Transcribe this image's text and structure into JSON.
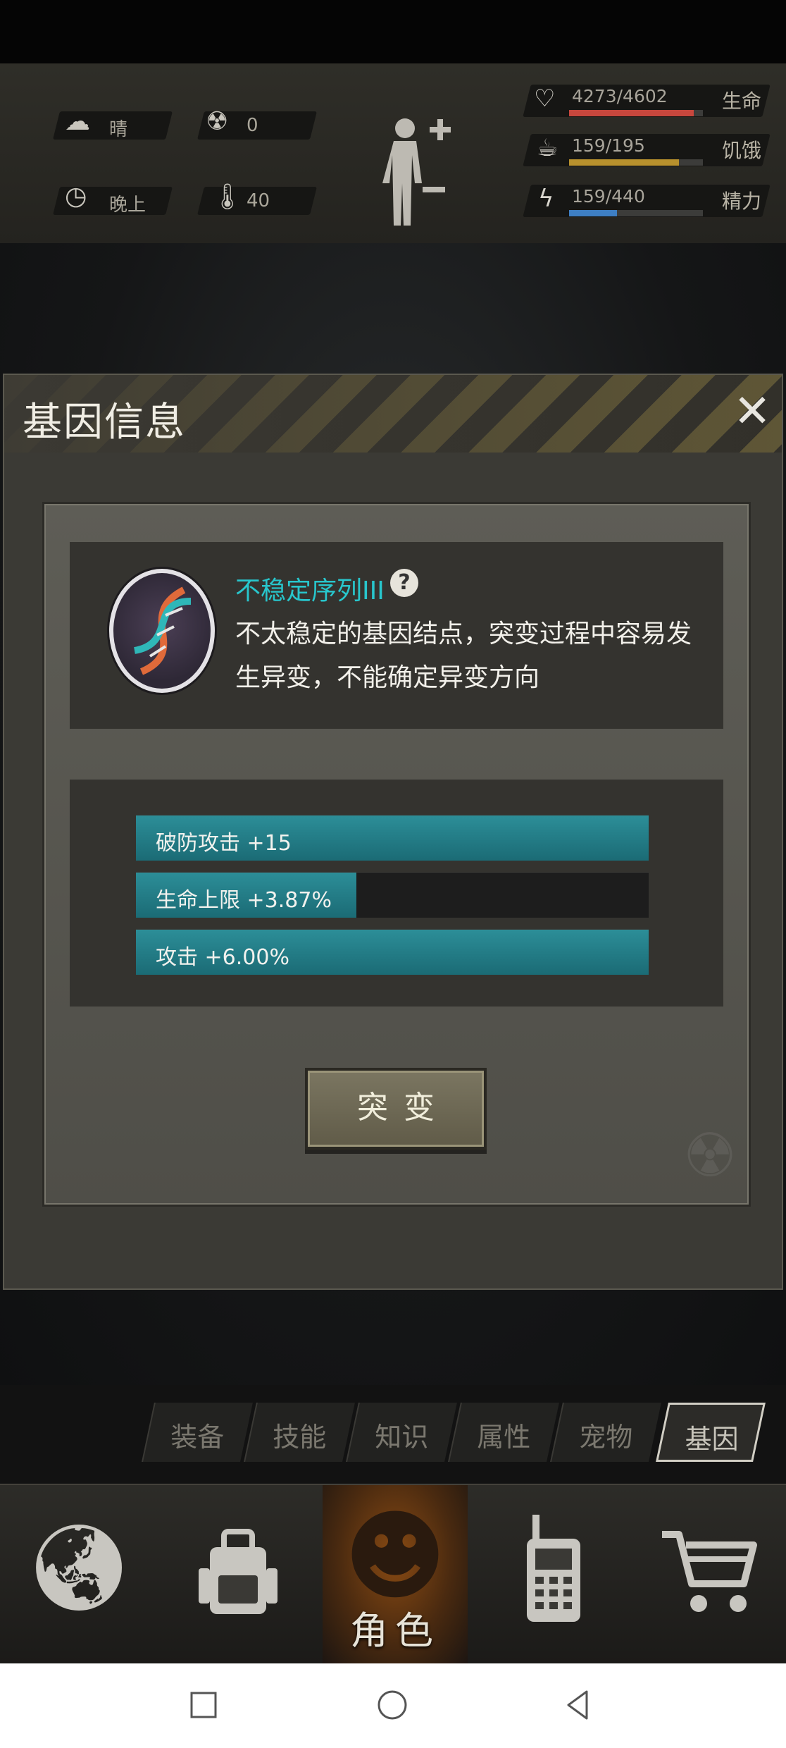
{
  "hud": {
    "weather": {
      "icon": "cloud-sun-icon",
      "label": "晴"
    },
    "radiation": {
      "icon": "radiation-icon",
      "value": "0"
    },
    "time": {
      "icon": "clock-icon",
      "label": "晚上"
    },
    "temperature": {
      "icon": "thermometer-icon",
      "value": "40"
    },
    "body_icon": "body-figure-icon",
    "stats": [
      {
        "name": "生命",
        "value": "4273/4602",
        "fraction": 0.93,
        "color": "#c8473d",
        "icon": "heart-pulse-icon"
      },
      {
        "name": "饥饿",
        "value": "159/195",
        "fraction": 0.82,
        "color": "#b8912d",
        "icon": "stomach-icon"
      },
      {
        "name": "精力",
        "value": "159/440",
        "fraction": 0.36,
        "color": "#3e7fc4",
        "icon": "energy-icon"
      }
    ]
  },
  "dialog": {
    "title": "基因信息",
    "close_icon": "close-icon",
    "gene": {
      "icon": "dna-icon",
      "name": "不稳定序列III",
      "help_icon": "?",
      "description": "不太稳定的基因结点，突变过程中容易发生异变，不能确定异变方向"
    },
    "bonuses": [
      {
        "label": "破防攻击 +15",
        "fraction": 1.0
      },
      {
        "label": "生命上限 +3.87%",
        "fraction": 0.43
      },
      {
        "label": "攻击 +6.00%",
        "fraction": 1.0
      }
    ],
    "mutate_label": "突变"
  },
  "tabs": [
    {
      "label": "装备",
      "active": false
    },
    {
      "label": "技能",
      "active": false
    },
    {
      "label": "知识",
      "active": false
    },
    {
      "label": "属性",
      "active": false
    },
    {
      "label": "宠物",
      "active": false
    },
    {
      "label": "基因",
      "active": true
    }
  ],
  "bottom_nav": {
    "items": [
      {
        "icon": "globe-icon"
      },
      {
        "icon": "backpack-icon"
      },
      {
        "icon": "character-head-icon",
        "label": "角色",
        "active": true
      },
      {
        "icon": "walkie-talkie-icon"
      },
      {
        "icon": "shopping-cart-icon"
      }
    ]
  },
  "system_nav": {
    "square_icon": "recents-icon",
    "circle_icon": "home-icon",
    "triangle_icon": "back-icon"
  }
}
